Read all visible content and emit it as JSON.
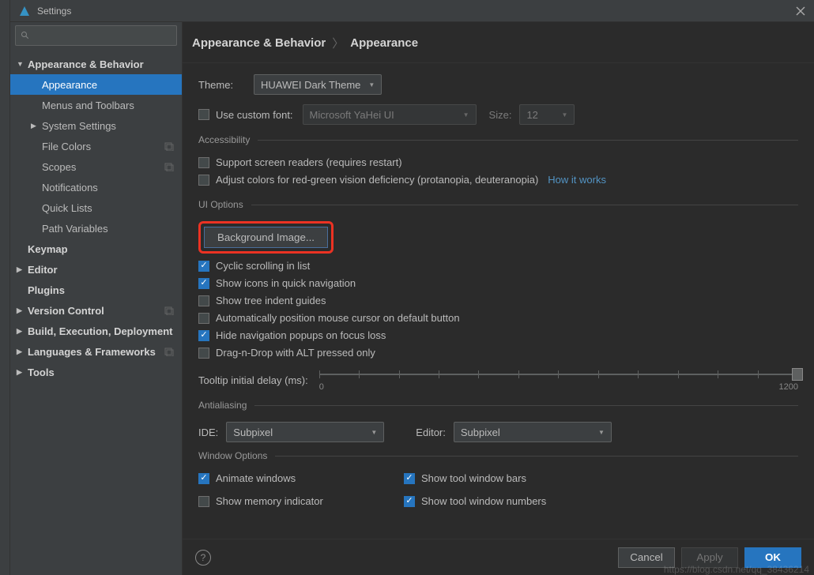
{
  "title": "Settings",
  "breadcrumb": {
    "a": "Appearance & Behavior",
    "b": "Appearance"
  },
  "sidebar": {
    "items": [
      {
        "label": "Appearance & Behavior",
        "level": 1,
        "arrow": "▼"
      },
      {
        "label": "Appearance",
        "level": 2,
        "selected": true
      },
      {
        "label": "Menus and Toolbars",
        "level": 2
      },
      {
        "label": "System Settings",
        "level": 2,
        "arrow": "▶"
      },
      {
        "label": "File Colors",
        "level": 2,
        "tag": true
      },
      {
        "label": "Scopes",
        "level": 2,
        "tag": true
      },
      {
        "label": "Notifications",
        "level": 2
      },
      {
        "label": "Quick Lists",
        "level": 2
      },
      {
        "label": "Path Variables",
        "level": 2
      },
      {
        "label": "Keymap",
        "level": 1
      },
      {
        "label": "Editor",
        "level": 1,
        "arrow": "▶"
      },
      {
        "label": "Plugins",
        "level": 1
      },
      {
        "label": "Version Control",
        "level": 1,
        "arrow": "▶",
        "tag": true
      },
      {
        "label": "Build, Execution, Deployment",
        "level": 1,
        "arrow": "▶"
      },
      {
        "label": "Languages & Frameworks",
        "level": 1,
        "arrow": "▶",
        "tag": true
      },
      {
        "label": "Tools",
        "level": 1,
        "arrow": "▶"
      }
    ]
  },
  "theme": {
    "label": "Theme:",
    "value": "HUAWEI Dark Theme"
  },
  "customFont": {
    "label": "Use custom font:",
    "font": "Microsoft YaHei UI",
    "sizeLabel": "Size:",
    "size": "12"
  },
  "sections": {
    "accessibility": {
      "title": "Accessibility",
      "r1": "Support screen readers (requires restart)",
      "r2": "Adjust colors for red-green vision deficiency (protanopia, deuteranopia)",
      "link": "How it works"
    },
    "ui": {
      "title": "UI Options",
      "bg": "Background Image...",
      "c1": "Cyclic scrolling in list",
      "c2": "Show icons in quick navigation",
      "c3": "Show tree indent guides",
      "c4": "Automatically position mouse cursor on default button",
      "c5": "Hide navigation popups on focus loss",
      "c6": "Drag-n-Drop with ALT pressed only",
      "tooltip": "Tooltip initial delay (ms):",
      "min": "0",
      "max": "1200"
    },
    "aa": {
      "title": "Antialiasing",
      "ideLabel": "IDE:",
      "ideVal": "Subpixel",
      "edLabel": "Editor:",
      "edVal": "Subpixel"
    },
    "wo": {
      "title": "Window Options",
      "c1": "Animate windows",
      "c2": "Show tool window bars",
      "c3": "Show memory indicator",
      "c4": "Show tool window numbers"
    }
  },
  "footer": {
    "cancel": "Cancel",
    "apply": "Apply",
    "ok": "OK"
  },
  "watermark": "https://blog.csdn.net/qq_38436214"
}
